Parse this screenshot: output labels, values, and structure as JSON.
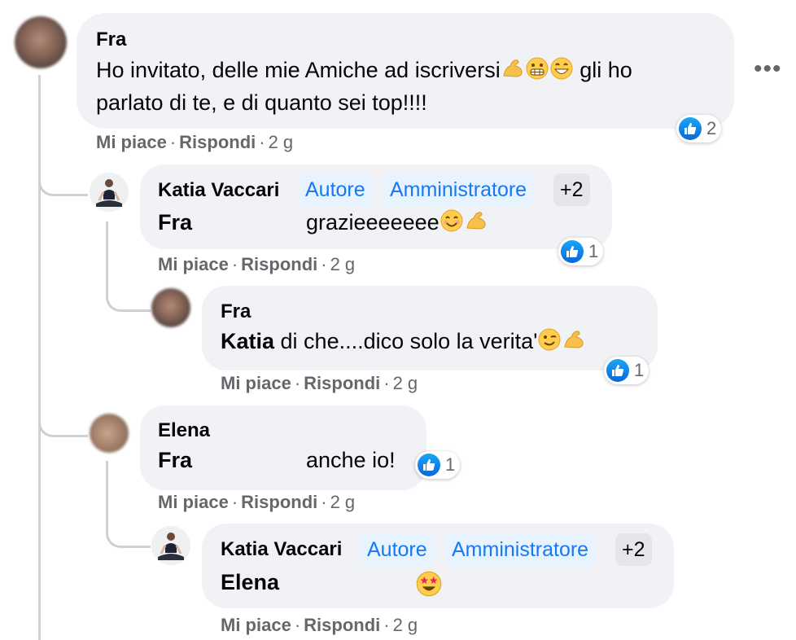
{
  "comments": [
    {
      "author": "Fra",
      "text": "Ho invitato, delle mie Amiche ad iscriversi",
      "text_after_emoji": "gli ho",
      "text_line2": "parlato di te, e di quanto sei top!!!!",
      "emojis": [
        "flexed-biceps-emoji",
        "grimacing-emoji",
        "grinning-emoji"
      ],
      "actions": {
        "like": "Mi piace",
        "reply": "Rispondi",
        "time": "2 g"
      },
      "reactions": "2"
    },
    {
      "author": "Katia Vaccari",
      "badges": [
        "Autore",
        "Amministratore",
        "+2"
      ],
      "mention": "Fra",
      "text": "grazieeeeeee",
      "emojis": [
        "smiling-emoji",
        "flexed-biceps-emoji"
      ],
      "actions": {
        "like": "Mi piace",
        "reply": "Rispondi",
        "time": "2 g"
      },
      "reactions": "1"
    },
    {
      "author": "Fra",
      "mention": "Katia",
      "text": " di che....dico solo la verita'",
      "emojis": [
        "winking-emoji",
        "flexed-biceps-emoji"
      ],
      "actions": {
        "like": "Mi piace",
        "reply": "Rispondi",
        "time": "2 g"
      },
      "reactions": "1"
    },
    {
      "author": "Elena",
      "mention": "Fra",
      "text": "anche io!",
      "actions": {
        "like": "Mi piace",
        "reply": "Rispondi",
        "time": "2 g"
      },
      "reactions": "1"
    },
    {
      "author": "Katia Vaccari",
      "badges": [
        "Autore",
        "Amministratore",
        "+2"
      ],
      "mention": "Elena",
      "emojis": [
        "star-struck-emoji"
      ],
      "actions": {
        "like": "Mi piace",
        "reply": "Rispondi",
        "time": "2 g"
      }
    }
  ],
  "separator": "·",
  "more_options_icon": "more-horizontal-icon",
  "colors": {
    "accent": "#1877f2",
    "bubble": "#f0f2f5",
    "secondary_text": "#65676b",
    "badge_bg": "#e7f3ff"
  }
}
